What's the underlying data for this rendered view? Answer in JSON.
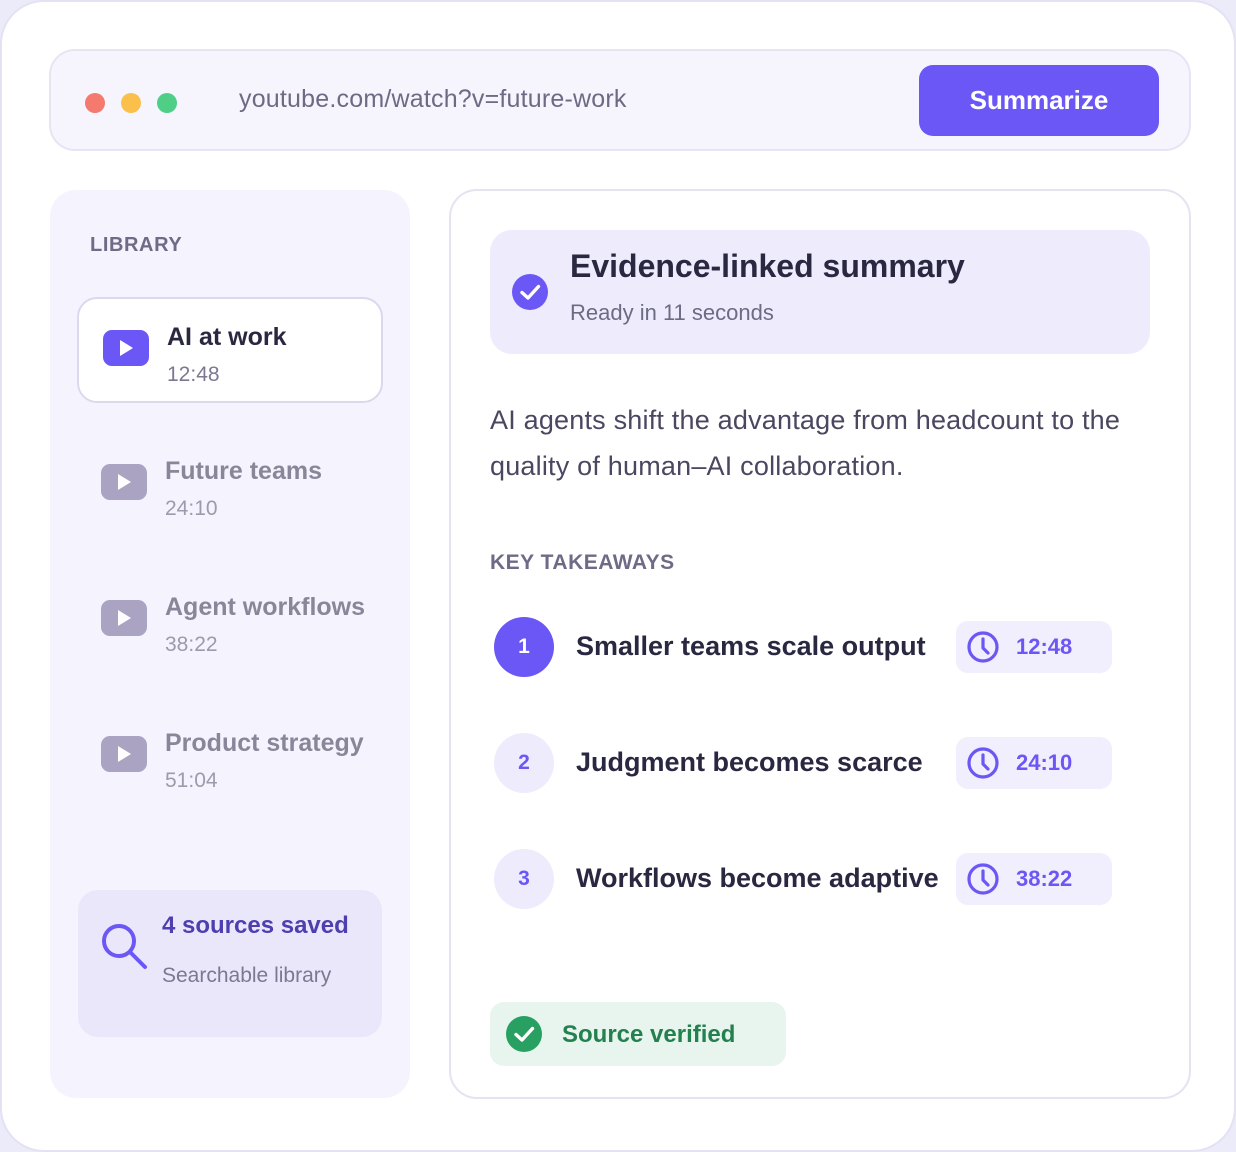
{
  "address_bar": {
    "url": "youtube.com/watch?v=future-work",
    "summarize_label": "Summarize"
  },
  "sidebar": {
    "label": "LIBRARY",
    "items": [
      {
        "title": "AI at work",
        "duration": "12:48",
        "active": true
      },
      {
        "title": "Future teams",
        "duration": "24:10",
        "active": false
      },
      {
        "title": "Agent workflows",
        "duration": "38:22",
        "active": false
      },
      {
        "title": "Product strategy",
        "duration": "51:04",
        "active": false
      }
    ],
    "sources": {
      "count_label": "4 sources saved",
      "subtitle": "Searchable library",
      "icon": "search-icon"
    }
  },
  "summary": {
    "title": "Evidence-linked summary",
    "status": "Ready in 11 seconds",
    "text": "AI agents shift the advantage from headcount to the quality of human–AI collaboration.",
    "takeaways_label": "KEY TAKEAWAYS",
    "takeaways": [
      {
        "number": "1",
        "text": "Smaller teams scale output",
        "timestamp": "12:48",
        "active": true
      },
      {
        "number": "2",
        "text": "Judgment becomes scarce",
        "timestamp": "24:10",
        "active": false
      },
      {
        "number": "3",
        "text": "Workflows become adaptive",
        "timestamp": "38:22",
        "active": false
      }
    ],
    "verified_label": "Source verified"
  },
  "colors": {
    "accent": "#6b57f5",
    "success": "#23804f",
    "muted_icon": "#aaa4c2"
  }
}
